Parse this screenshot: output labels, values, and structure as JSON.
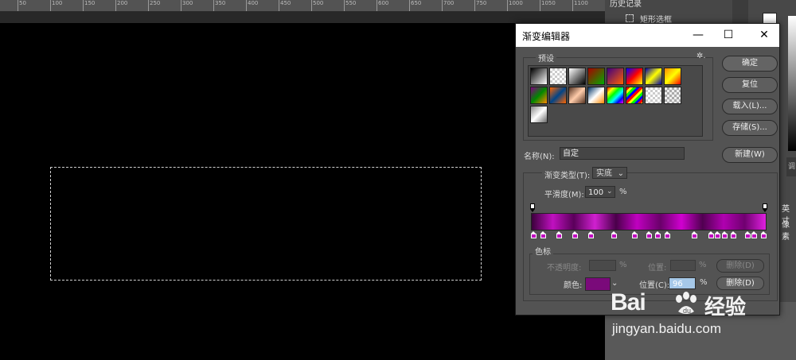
{
  "ruler": {
    "ticks": [
      "50",
      "100",
      "150",
      "200",
      "250",
      "300",
      "350",
      "400",
      "450",
      "500",
      "550",
      "600",
      "650",
      "700",
      "750",
      "1000",
      "1050",
      "1100"
    ]
  },
  "right_panel": {
    "tab_label": "历史记录",
    "history_item": "矩形选框",
    "label_inch": "英寸",
    "label_pixel": "像素",
    "small_label": "调"
  },
  "dialog": {
    "title": "渐变编辑器",
    "window_buttons": {
      "minimize": "—",
      "maximize": "☐",
      "close": "✕"
    },
    "presets_label": "预设",
    "gear_label": "✲.",
    "buttons": {
      "ok": "确定",
      "reset": "复位",
      "load": "载入(L)...",
      "save": "存储(S)...",
      "new": "新建(W)"
    },
    "name_label": "名称(N):",
    "name_value": "自定",
    "gradient_type_label": "渐变类型(T):",
    "gradient_type_value": "实底",
    "smoothness_label": "平滑度(M):",
    "smoothness_value": "100",
    "smoothness_unit": "%",
    "stops_label": "色标",
    "opacity_label": "不透明度:",
    "opacity_unit": "%",
    "opacity_position_label": "位置:",
    "opacity_position_unit": "%",
    "opacity_delete": "删除(D)",
    "color_label": "颜色:",
    "color_value": "#7a0a7a",
    "color_position_label": "位置(C):",
    "color_position_value": "96",
    "color_position_unit": "%",
    "color_delete": "删除(D)"
  },
  "gradient": {
    "bar_colors": [
      "#3a003a",
      "#c010c0",
      "#5a005a",
      "#d020d0",
      "#4a004a",
      "#c000c0",
      "#6a006a",
      "#d000d0",
      "#500050",
      "#b000b0",
      "#700070",
      "#e020e0"
    ],
    "color_stop_positions": [
      0,
      4,
      11,
      18,
      25,
      35,
      44,
      50,
      54,
      58,
      70,
      77,
      80,
      83,
      87,
      93,
      96,
      100
    ]
  },
  "watermark": {
    "brand": "Bai",
    "brand_cn": "经验",
    "url": "jingyan.baidu.com"
  }
}
